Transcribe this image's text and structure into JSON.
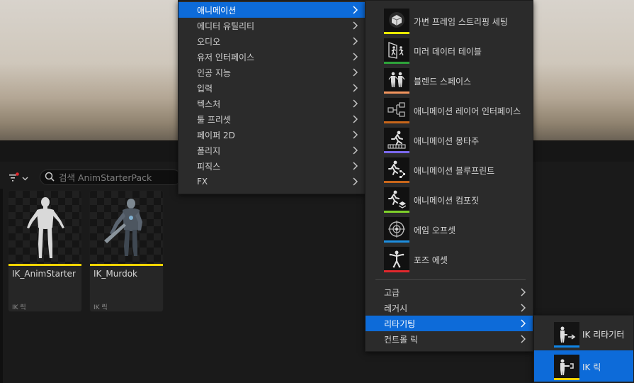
{
  "search": {
    "placeholder": "검색 AnimStarterPack"
  },
  "assets": [
    {
      "name": "IK_AnimStarter",
      "type": "IK 릭"
    },
    {
      "name": "IK_Murdok",
      "type": "IK 릭"
    }
  ],
  "main_menu": {
    "items": [
      {
        "label": "애니메이션"
      },
      {
        "label": "에디터 유틸리티"
      },
      {
        "label": "오디오"
      },
      {
        "label": "유저 인터페이스"
      },
      {
        "label": "인공 지능"
      },
      {
        "label": "입력"
      },
      {
        "label": "텍스처"
      },
      {
        "label": "툴 프리셋"
      },
      {
        "label": "페이퍼 2D"
      },
      {
        "label": "폴리지"
      },
      {
        "label": "피직스"
      },
      {
        "label": "FX"
      }
    ]
  },
  "animation_menu": {
    "items": [
      {
        "label": "가변 프레임 스트리핑 세팅",
        "icon": "cube-icon",
        "stripe": "#e8e800"
      },
      {
        "label": "미러 데이터 테이블",
        "icon": "mirror-table-icon",
        "stripe": "#2ea43a"
      },
      {
        "label": "블렌드 스페이스",
        "icon": "blend-space-icon",
        "stripe": "#f2955e"
      },
      {
        "label": "애니메이션 레이어 인터페이스",
        "icon": "layer-interface-icon",
        "stripe": "#c8661a"
      },
      {
        "label": "애니메이션 몽타주",
        "icon": "montage-icon",
        "stripe": "#7b68ee"
      },
      {
        "label": "애니메이션 블루프린트",
        "icon": "anim-blueprint-icon",
        "stripe": "#c8661a"
      },
      {
        "label": "애니메이션 컴포짓",
        "icon": "composite-icon",
        "stripe": "#7fd12a"
      },
      {
        "label": "에임 오프셋",
        "icon": "aim-offset-icon",
        "stripe": "#1e8fe0"
      },
      {
        "label": "포즈 에셋",
        "icon": "pose-asset-icon",
        "stripe": "#e0282d"
      }
    ],
    "groups": [
      {
        "label": "고급"
      },
      {
        "label": "레거시"
      },
      {
        "label": "리타기팅"
      },
      {
        "label": "컨트롤 릭"
      }
    ]
  },
  "retargeting_menu": {
    "items": [
      {
        "label": "IK 리타기터",
        "icon": "ik-retargeter-icon"
      },
      {
        "label": "IK 릭",
        "icon": "ik-rig-icon"
      }
    ]
  },
  "colors": {
    "accent": "#0d6bd9",
    "ik_rig_stripe": "#f0d400"
  }
}
